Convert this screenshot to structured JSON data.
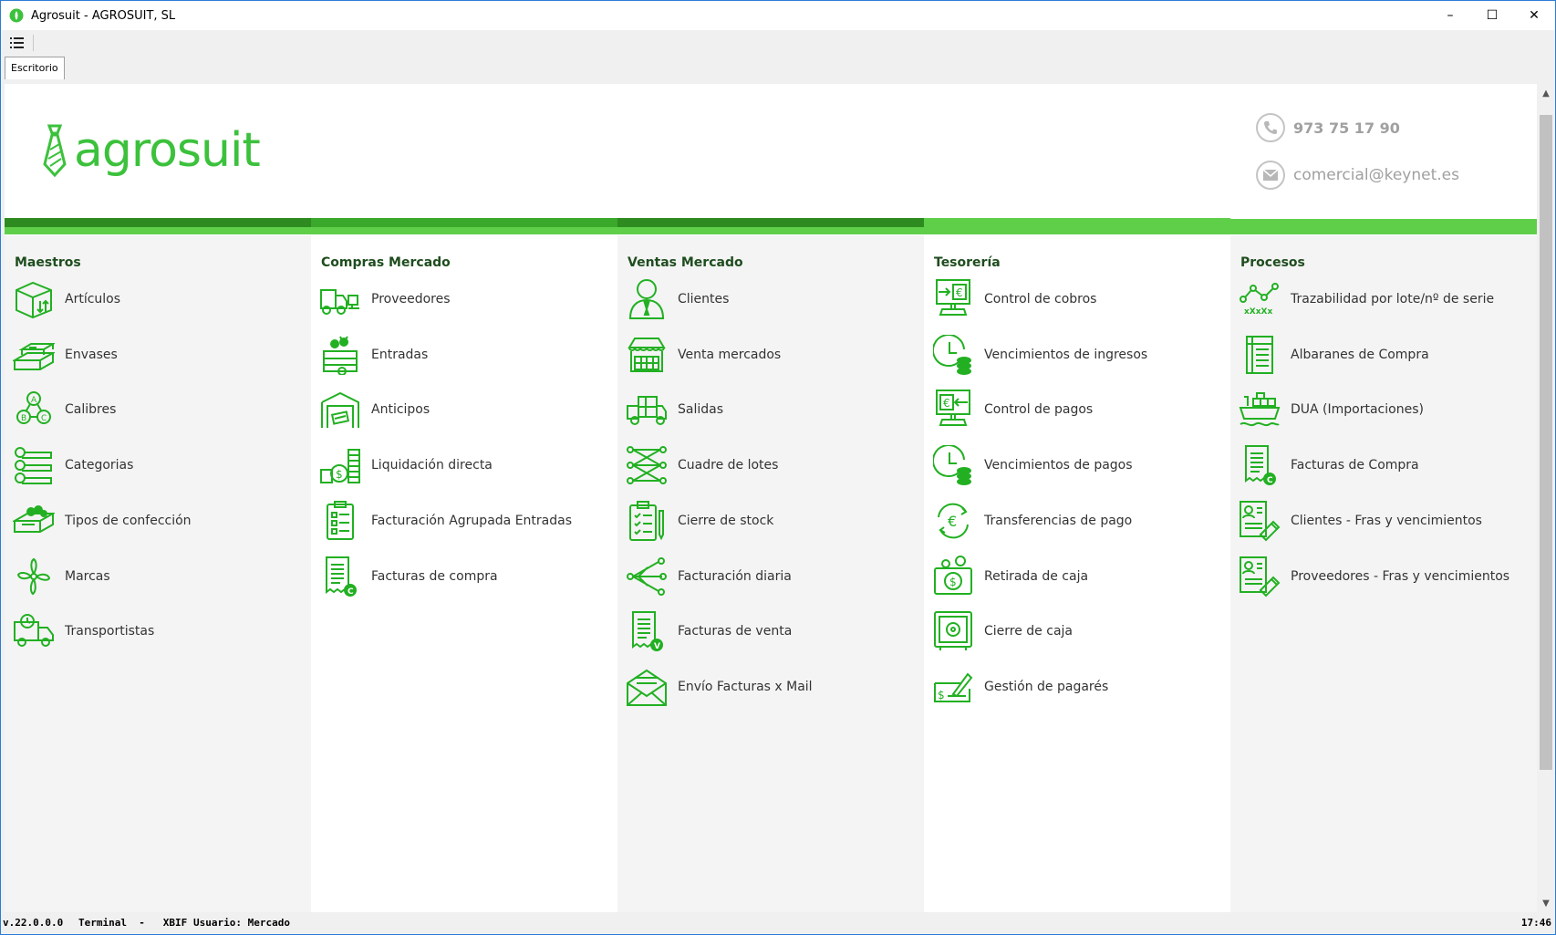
{
  "window": {
    "title": "Agrosuit - AGROSUIT, SL",
    "min": "–",
    "max": "☐",
    "close": "✕"
  },
  "tabs": [
    {
      "label": "Escritorio"
    }
  ],
  "header": {
    "logo_text": "agrosuit",
    "phone": "973 75 17 90",
    "email": "comercial@keynet.es"
  },
  "colors": {
    "accent": "#3cc13c",
    "bar_light": "#5fcf4a",
    "bar_dark": "#2e8b1f",
    "panel_title": "#1f4d1f"
  },
  "panels": [
    {
      "title": "Maestros",
      "items": [
        {
          "label": "Artículos",
          "icon": "box-icon"
        },
        {
          "label": "Envases",
          "icon": "crates-icon"
        },
        {
          "label": "Calibres",
          "icon": "calibres-abc-icon"
        },
        {
          "label": "Categorias",
          "icon": "categories-icon"
        },
        {
          "label": "Tipos de confección",
          "icon": "produce-tray-icon"
        },
        {
          "label": "Marcas",
          "icon": "brand-icon"
        },
        {
          "label": "Transportistas",
          "icon": "truck-clock-icon"
        }
      ]
    },
    {
      "title": "Compras Mercado",
      "items": [
        {
          "label": "Proveedores",
          "icon": "supplier-truck-icon"
        },
        {
          "label": "Entradas",
          "icon": "incoming-crate-icon"
        },
        {
          "label": "Anticipos",
          "icon": "warehouse-money-icon"
        },
        {
          "label": "Liquidación directa",
          "icon": "coins-stack-icon"
        },
        {
          "label": "Facturación Agrupada Entradas",
          "icon": "grouped-invoice-icon"
        },
        {
          "label": "Facturas de compra",
          "icon": "purchase-invoice-icon"
        }
      ]
    },
    {
      "title": "Ventas Mercado",
      "items": [
        {
          "label": "Clientes",
          "icon": "client-icon"
        },
        {
          "label": "Venta mercados",
          "icon": "market-stall-icon"
        },
        {
          "label": "Salidas",
          "icon": "delivery-truck-icon"
        },
        {
          "label": "Cuadre de lotes",
          "icon": "batch-reconcile-icon"
        },
        {
          "label": "Cierre de stock",
          "icon": "stock-checklist-icon"
        },
        {
          "label": "Facturación diaria",
          "icon": "daily-billing-icon"
        },
        {
          "label": "Facturas de venta",
          "icon": "sales-invoice-icon"
        },
        {
          "label": "Envío Facturas x Mail",
          "icon": "mail-envelope-icon"
        }
      ]
    },
    {
      "title": "Tesorería",
      "items": [
        {
          "label": "Control de cobros",
          "icon": "collections-monitor-icon"
        },
        {
          "label": "Vencimientos de ingresos",
          "icon": "income-due-clock-icon"
        },
        {
          "label": "Control de pagos",
          "icon": "payments-monitor-icon"
        },
        {
          "label": "Vencimientos de pagos",
          "icon": "payments-due-clock-icon"
        },
        {
          "label": "Transferencias de pago",
          "icon": "euro-transfer-icon"
        },
        {
          "label": "Retirada de caja",
          "icon": "cash-withdraw-icon"
        },
        {
          "label": "Cierre de caja",
          "icon": "safe-icon"
        },
        {
          "label": "Gestión de pagarés",
          "icon": "promissory-note-icon"
        }
      ]
    },
    {
      "title": "Procesos",
      "items": [
        {
          "label": "Trazabilidad por lote/nº de serie",
          "icon": "traceability-icon"
        },
        {
          "label": "Albaranes de Compra",
          "icon": "delivery-note-icon"
        },
        {
          "label": "DUA (Importaciones)",
          "icon": "cargo-ship-icon"
        },
        {
          "label": "Facturas de Compra",
          "icon": "purchase-invoice-icon"
        },
        {
          "label": "Clientes - Fras y vencimientos",
          "icon": "client-invoices-icon"
        },
        {
          "label": "Proveedores - Fras y vencimientos",
          "icon": "supplier-invoices-icon"
        }
      ]
    }
  ],
  "status": {
    "version": "v.22.0.0.0",
    "terminal": "Terminal  -   XBIF",
    "user": "Usuario: Mercado",
    "time": "17:46"
  }
}
